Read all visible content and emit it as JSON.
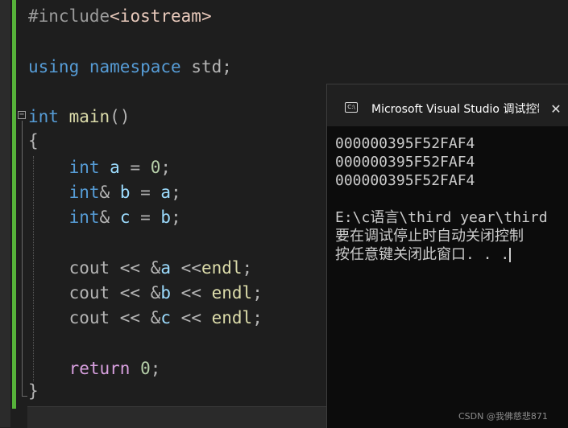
{
  "editor": {
    "code_lines": [
      {
        "parts": [
          [
            "pp",
            "#include"
          ],
          [
            "inc",
            "<iostream>"
          ]
        ]
      },
      {
        "parts": [
          [
            "kw",
            "using"
          ],
          [
            "op",
            " "
          ],
          [
            "kw",
            "namespace"
          ],
          [
            "op",
            " std;"
          ]
        ]
      },
      {
        "parts": [
          [
            "kw",
            "int"
          ],
          [
            "op",
            " "
          ],
          [
            "fn",
            "main"
          ],
          [
            "op",
            "()"
          ]
        ]
      },
      {
        "parts": [
          [
            "op",
            "{"
          ]
        ]
      },
      {
        "parts": [
          [
            "op",
            "    "
          ],
          [
            "kw",
            "int"
          ],
          [
            "op",
            " "
          ],
          [
            "var",
            "a"
          ],
          [
            "op",
            " = "
          ],
          [
            "num",
            "0"
          ],
          [
            "op",
            ";"
          ]
        ]
      },
      {
        "parts": [
          [
            "op",
            "    "
          ],
          [
            "kw",
            "int"
          ],
          [
            "op",
            "& "
          ],
          [
            "var",
            "b"
          ],
          [
            "op",
            " = "
          ],
          [
            "var",
            "a"
          ],
          [
            "op",
            ";"
          ]
        ]
      },
      {
        "parts": [
          [
            "op",
            "    "
          ],
          [
            "kw",
            "int"
          ],
          [
            "op",
            "& "
          ],
          [
            "var",
            "c"
          ],
          [
            "op",
            " = "
          ],
          [
            "var",
            "b"
          ],
          [
            "op",
            ";"
          ]
        ]
      },
      {
        "parts": [
          [
            "op",
            "    cout << &"
          ],
          [
            "var",
            "a"
          ],
          [
            "op",
            " <<"
          ],
          [
            "fn",
            "endl"
          ],
          [
            "op",
            ";"
          ]
        ]
      },
      {
        "parts": [
          [
            "op",
            "    cout << &"
          ],
          [
            "var",
            "b"
          ],
          [
            "op",
            " << "
          ],
          [
            "fn",
            "endl"
          ],
          [
            "op",
            ";"
          ]
        ]
      },
      {
        "parts": [
          [
            "op",
            "    cout << &"
          ],
          [
            "var",
            "c"
          ],
          [
            "op",
            " << "
          ],
          [
            "fn",
            "endl"
          ],
          [
            "op",
            ";"
          ]
        ]
      },
      {
        "parts": [
          [
            "op",
            "    "
          ],
          [
            "ret",
            "return"
          ],
          [
            "op",
            " "
          ],
          [
            "num",
            "0"
          ],
          [
            "op",
            ";"
          ]
        ]
      },
      {
        "parts": [
          [
            "op",
            "}"
          ]
        ]
      }
    ]
  },
  "console": {
    "title": "Microsoft Visual Studio 调试控制台",
    "icon": "console-app-icon",
    "close_symbol": "✕",
    "output_lines": [
      "000000395F52FAF4",
      "000000395F52FAF4",
      "000000395F52FAF4",
      "",
      "E:\\c语言\\third year\\third",
      "要在调试停止时自动关闭控制",
      "按任意键关闭此窗口. . ."
    ]
  },
  "watermark": "CSDN @我佛慈悲871",
  "colors": {
    "background": "#1e1e1e",
    "keyword": "#569cd6",
    "function": "#dcdcaa",
    "variable": "#9cdcfe",
    "number": "#b5cea8",
    "return_keyword": "#d8a0df",
    "change_bar": "#56b23a",
    "console_bg": "#0c0c0c"
  }
}
